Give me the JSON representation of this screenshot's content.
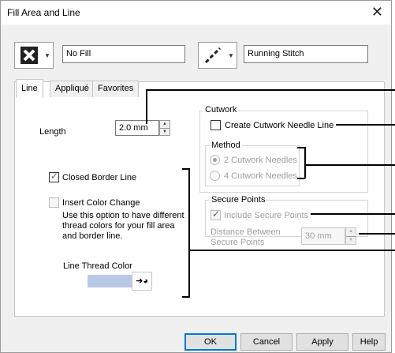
{
  "window": {
    "title": "Fill Area and Line",
    "close_glyph": "✕"
  },
  "fill": {
    "value": "No Fill",
    "icon": "no-fill-icon"
  },
  "line": {
    "value": "Running Stitch",
    "icon": "running-stitch-icon"
  },
  "tabs": [
    {
      "label": "Line"
    },
    {
      "label": "Appliqué"
    },
    {
      "label": "Favorites"
    }
  ],
  "line_tab": {
    "length_label": "Length",
    "length_value": "2.0 mm",
    "closed_border_label": "Closed Border Line",
    "insert_color_change_label": "Insert Color Change",
    "help_text_lines": [
      "Use this option to have different",
      "thread colors for your fill area",
      "and border line."
    ],
    "line_thread_color_label": "Line Thread Color",
    "thread_color_swatch": "#b9c8e6"
  },
  "cutwork": {
    "group_label": "Cutwork",
    "create_label": "Create Cutwork Needle Line",
    "method_label": "Method",
    "option_2": "2 Cutwork Needles",
    "option_4": "4 Cutwork Needles"
  },
  "secure_points": {
    "group_label": "Secure Points",
    "include_label": "Include Secure Points",
    "distance_label_lines": [
      "Distance Between",
      "Secure Points"
    ],
    "distance_value": "30 mm"
  },
  "buttons": {
    "ok": "OK",
    "cancel": "Cancel",
    "apply": "Apply",
    "help": "Help"
  }
}
